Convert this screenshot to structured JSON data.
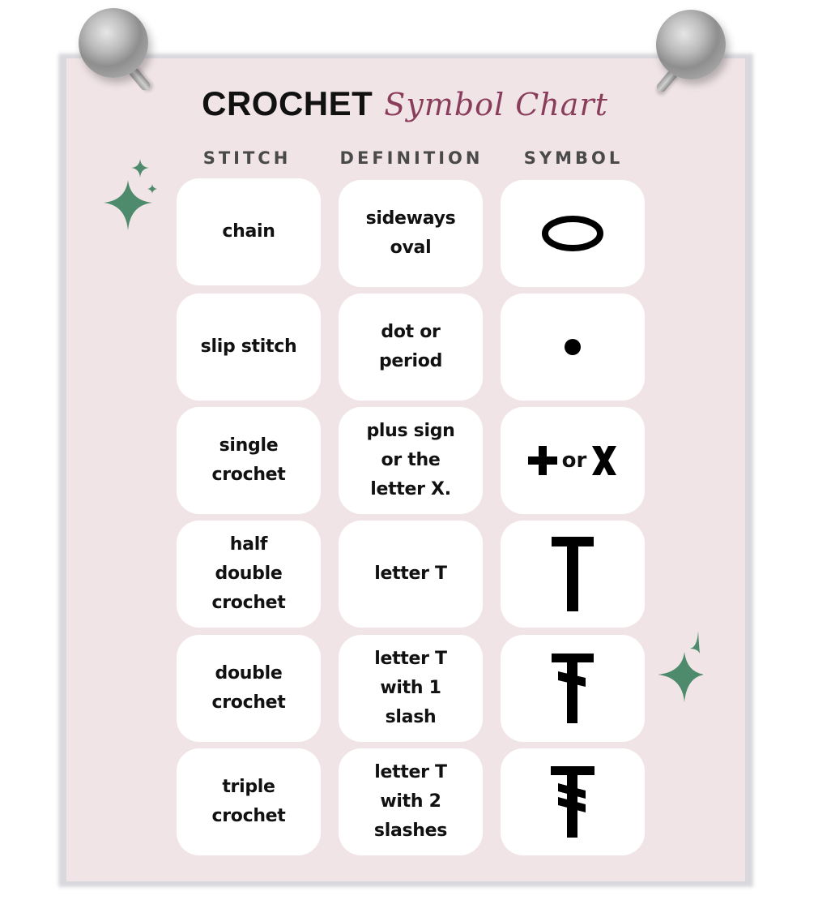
{
  "title": {
    "main": "CROCHET",
    "sub": "Symbol Chart"
  },
  "colors": {
    "paper": "#f0e4e6",
    "accent": "#8a3d5a",
    "sparkle": "#4e8a6c",
    "header_text": "#4a4a4a"
  },
  "headers": [
    "STITCH",
    "DEFINITION",
    "SYMBOL"
  ],
  "rows": [
    {
      "stitch": "chain",
      "definition": "sideways\noval",
      "symbol": "oval-icon"
    },
    {
      "stitch": "slip stitch",
      "definition": "dot or\nperiod",
      "symbol": "dot-icon"
    },
    {
      "stitch": "single\ncrochet",
      "definition": "plus sign\nor the\nletter X.",
      "symbol": "plus-or-x-icon",
      "symbol_text": {
        "or": "or",
        "x": "X"
      }
    },
    {
      "stitch": "half\ndouble\ncrochet",
      "definition": "letter T",
      "symbol": "letter-t-icon"
    },
    {
      "stitch": "double\ncrochet",
      "definition": "letter T\nwith 1\nslash",
      "symbol": "t-one-slash-icon"
    },
    {
      "stitch": "triple\ncrochet",
      "definition": "letter T\nwith 2\nslashes",
      "symbol": "t-two-slashes-icon"
    }
  ]
}
